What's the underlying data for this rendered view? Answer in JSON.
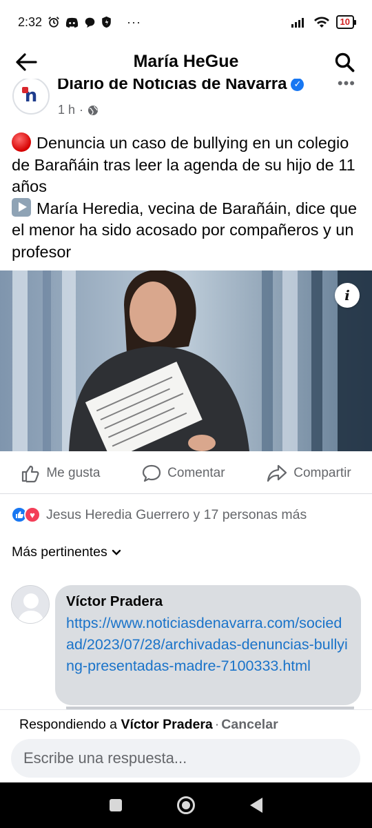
{
  "status_bar": {
    "time": "2:32",
    "overflow": "···",
    "battery": "10"
  },
  "top_bar": {
    "title": "María HeGue"
  },
  "post": {
    "page_name": "Diario de Noticias de Navarra",
    "page_logo": "n",
    "time": "1 h",
    "separator": "·",
    "text_line1": "Denuncia un caso de bullying en un colegio de Barañáin tras leer la agenda de su hijo de 11 años",
    "text_line2": "María Heredia, vecina de Barañáin, dice que el menor ha sido acosado por compañeros y un profesor",
    "info_label": "i"
  },
  "actions": {
    "like": "Me gusta",
    "comment": "Comentar",
    "share": "Compartir"
  },
  "reactions": {
    "summary": "Jesus Heredia Guerrero y 17 personas más"
  },
  "comments": {
    "sort_label": "Más pertinentes",
    "items": [
      {
        "author": "Víctor Pradera",
        "link": "https://www.noticiasdenavarra.com/sociedad/2023/07/28/archivadas-denuncias-bullying-presentadas-madre-7100333.html"
      }
    ]
  },
  "reply": {
    "prefix": "Respondiendo a",
    "target": "Víctor Pradera",
    "dot": "·",
    "cancel": "Cancelar",
    "placeholder": "Escribe una respuesta..."
  },
  "colors": {
    "link": "#1a73c9",
    "accent": "#1877f2",
    "love": "#f33e58",
    "bubble": "#dadde1"
  },
  "icons": [
    "alarm-icon",
    "discord-icon",
    "chat-bubble-icon",
    "shield-icon",
    "signal-icon",
    "wifi-icon",
    "battery-icon",
    "back-arrow-icon",
    "search-icon",
    "globe-icon",
    "more-icon",
    "thumbs-up-icon",
    "comment-icon",
    "share-icon",
    "chevron-down-icon"
  ]
}
